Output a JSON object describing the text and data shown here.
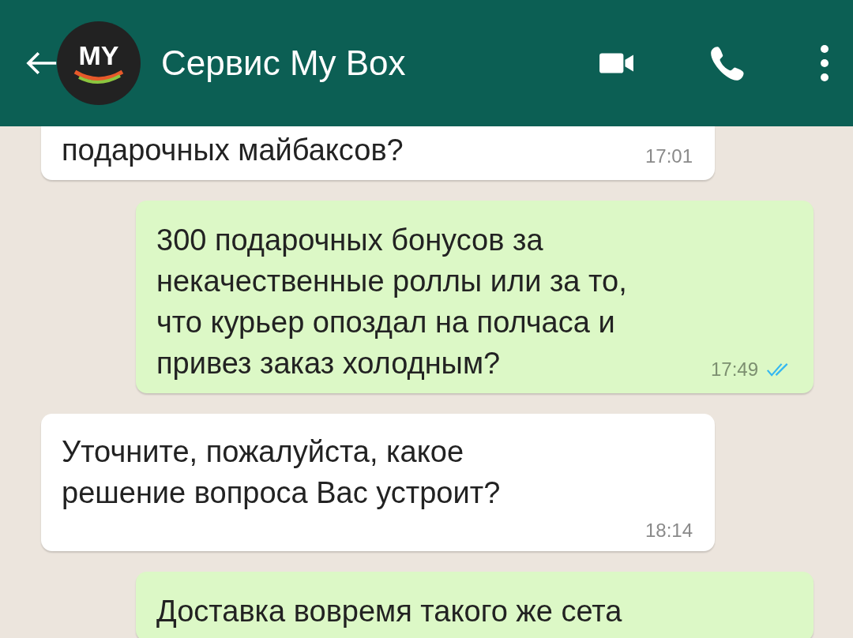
{
  "header": {
    "logo_text": "MY",
    "title": "Сервис My Box"
  },
  "messages": [
    {
      "kind": "in",
      "lines": [
        "подарочных майбаксов?"
      ],
      "time": "17:01"
    },
    {
      "kind": "out",
      "lines": [
        "300 подарочных бонусов за",
        "некачественные роллы или за то,",
        "что курьер опоздал на полчаса и",
        "привез заказ холодным?"
      ],
      "time": "17:49",
      "read": true
    },
    {
      "kind": "in",
      "lines": [
        "Уточните, пожалуйста, какое",
        "решение вопроса Вас устроит?"
      ],
      "time": "18:14",
      "time_below": true
    },
    {
      "kind": "out",
      "lines": [
        "Доставка вовремя такого же сета"
      ]
    }
  ]
}
